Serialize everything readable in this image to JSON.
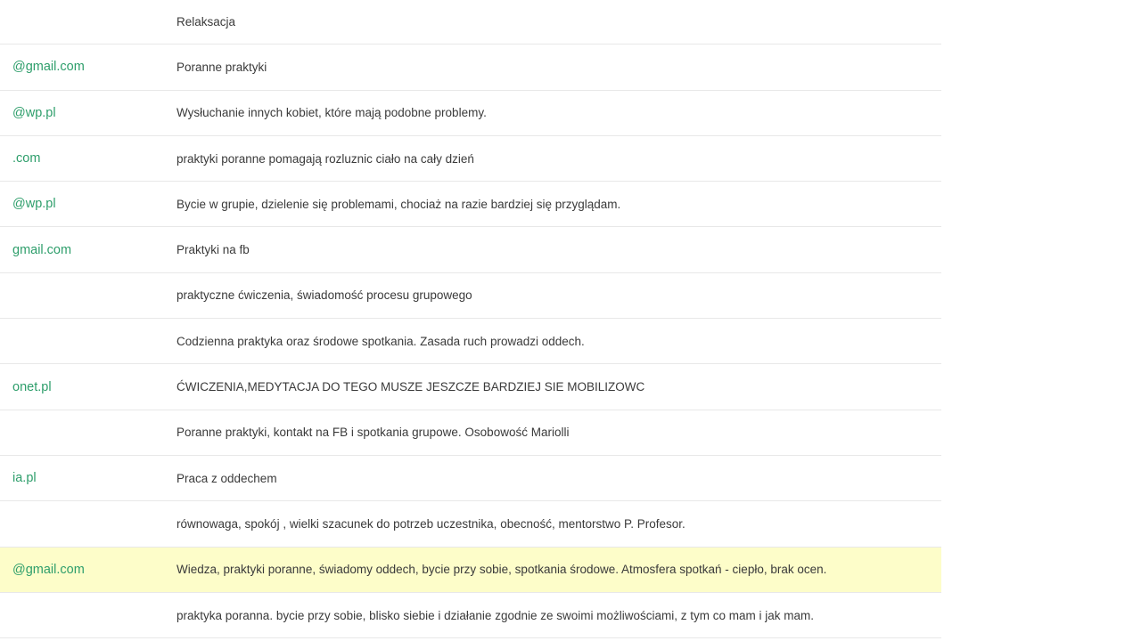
{
  "table": {
    "rows": [
      {
        "email": "",
        "answer": "Relaksacja",
        "highlighted": false
      },
      {
        "email": "@gmail.com",
        "answer": "Poranne praktyki",
        "highlighted": false
      },
      {
        "email": "@wp.pl",
        "answer": "Wysłuchanie innych kobiet, które mają podobne problemy.",
        "highlighted": false
      },
      {
        "email": ".com",
        "answer": "praktyki poranne pomagają rozluznic ciało na cały dzień",
        "highlighted": false
      },
      {
        "email": "@wp.pl",
        "answer": "Bycie w grupie, dzielenie się problemami, chociaż na razie bardziej się przyglądam.",
        "highlighted": false
      },
      {
        "email": "gmail.com",
        "answer": "Praktyki na fb",
        "highlighted": false
      },
      {
        "email": "",
        "answer": "praktyczne ćwiczenia, świadomość procesu grupowego",
        "highlighted": false
      },
      {
        "email": "",
        "answer": "Codzienna praktyka oraz środowe spotkania. Zasada ruch prowadzi oddech.",
        "highlighted": false
      },
      {
        "email": "onet.pl",
        "answer": "ĆWICZENIA,MEDYTACJA DO TEGO MUSZE JESZCZE BARDZIEJ SIE MOBILIZOWC",
        "highlighted": false
      },
      {
        "email": "",
        "answer": "Poranne praktyki, kontakt na FB i spotkania grupowe. Osobowość Mariolli",
        "highlighted": false
      },
      {
        "email": "ia.pl",
        "answer": "Praca z oddechem",
        "highlighted": false
      },
      {
        "email": "",
        "answer": "równowaga, spokój , wielki szacunek do potrzeb uczestnika, obecność, mentorstwo P. Profesor.",
        "highlighted": false
      },
      {
        "email": "@gmail.com",
        "answer": "Wiedza, praktyki poranne, świadomy oddech, bycie przy sobie, spotkania środowe. Atmosfera spotkań - ciepło, brak ocen.",
        "highlighted": true
      },
      {
        "email": "",
        "answer": "praktyka poranna. bycie przy sobie, blisko siebie i działanie zgodnie ze swoimi możliwościami, z tym co mam i jak mam.",
        "highlighted": false
      }
    ]
  },
  "colors": {
    "email_link": "#2e9e6b",
    "highlight_row": "#fdfdc9",
    "row_divider": "#e8e8e8"
  }
}
